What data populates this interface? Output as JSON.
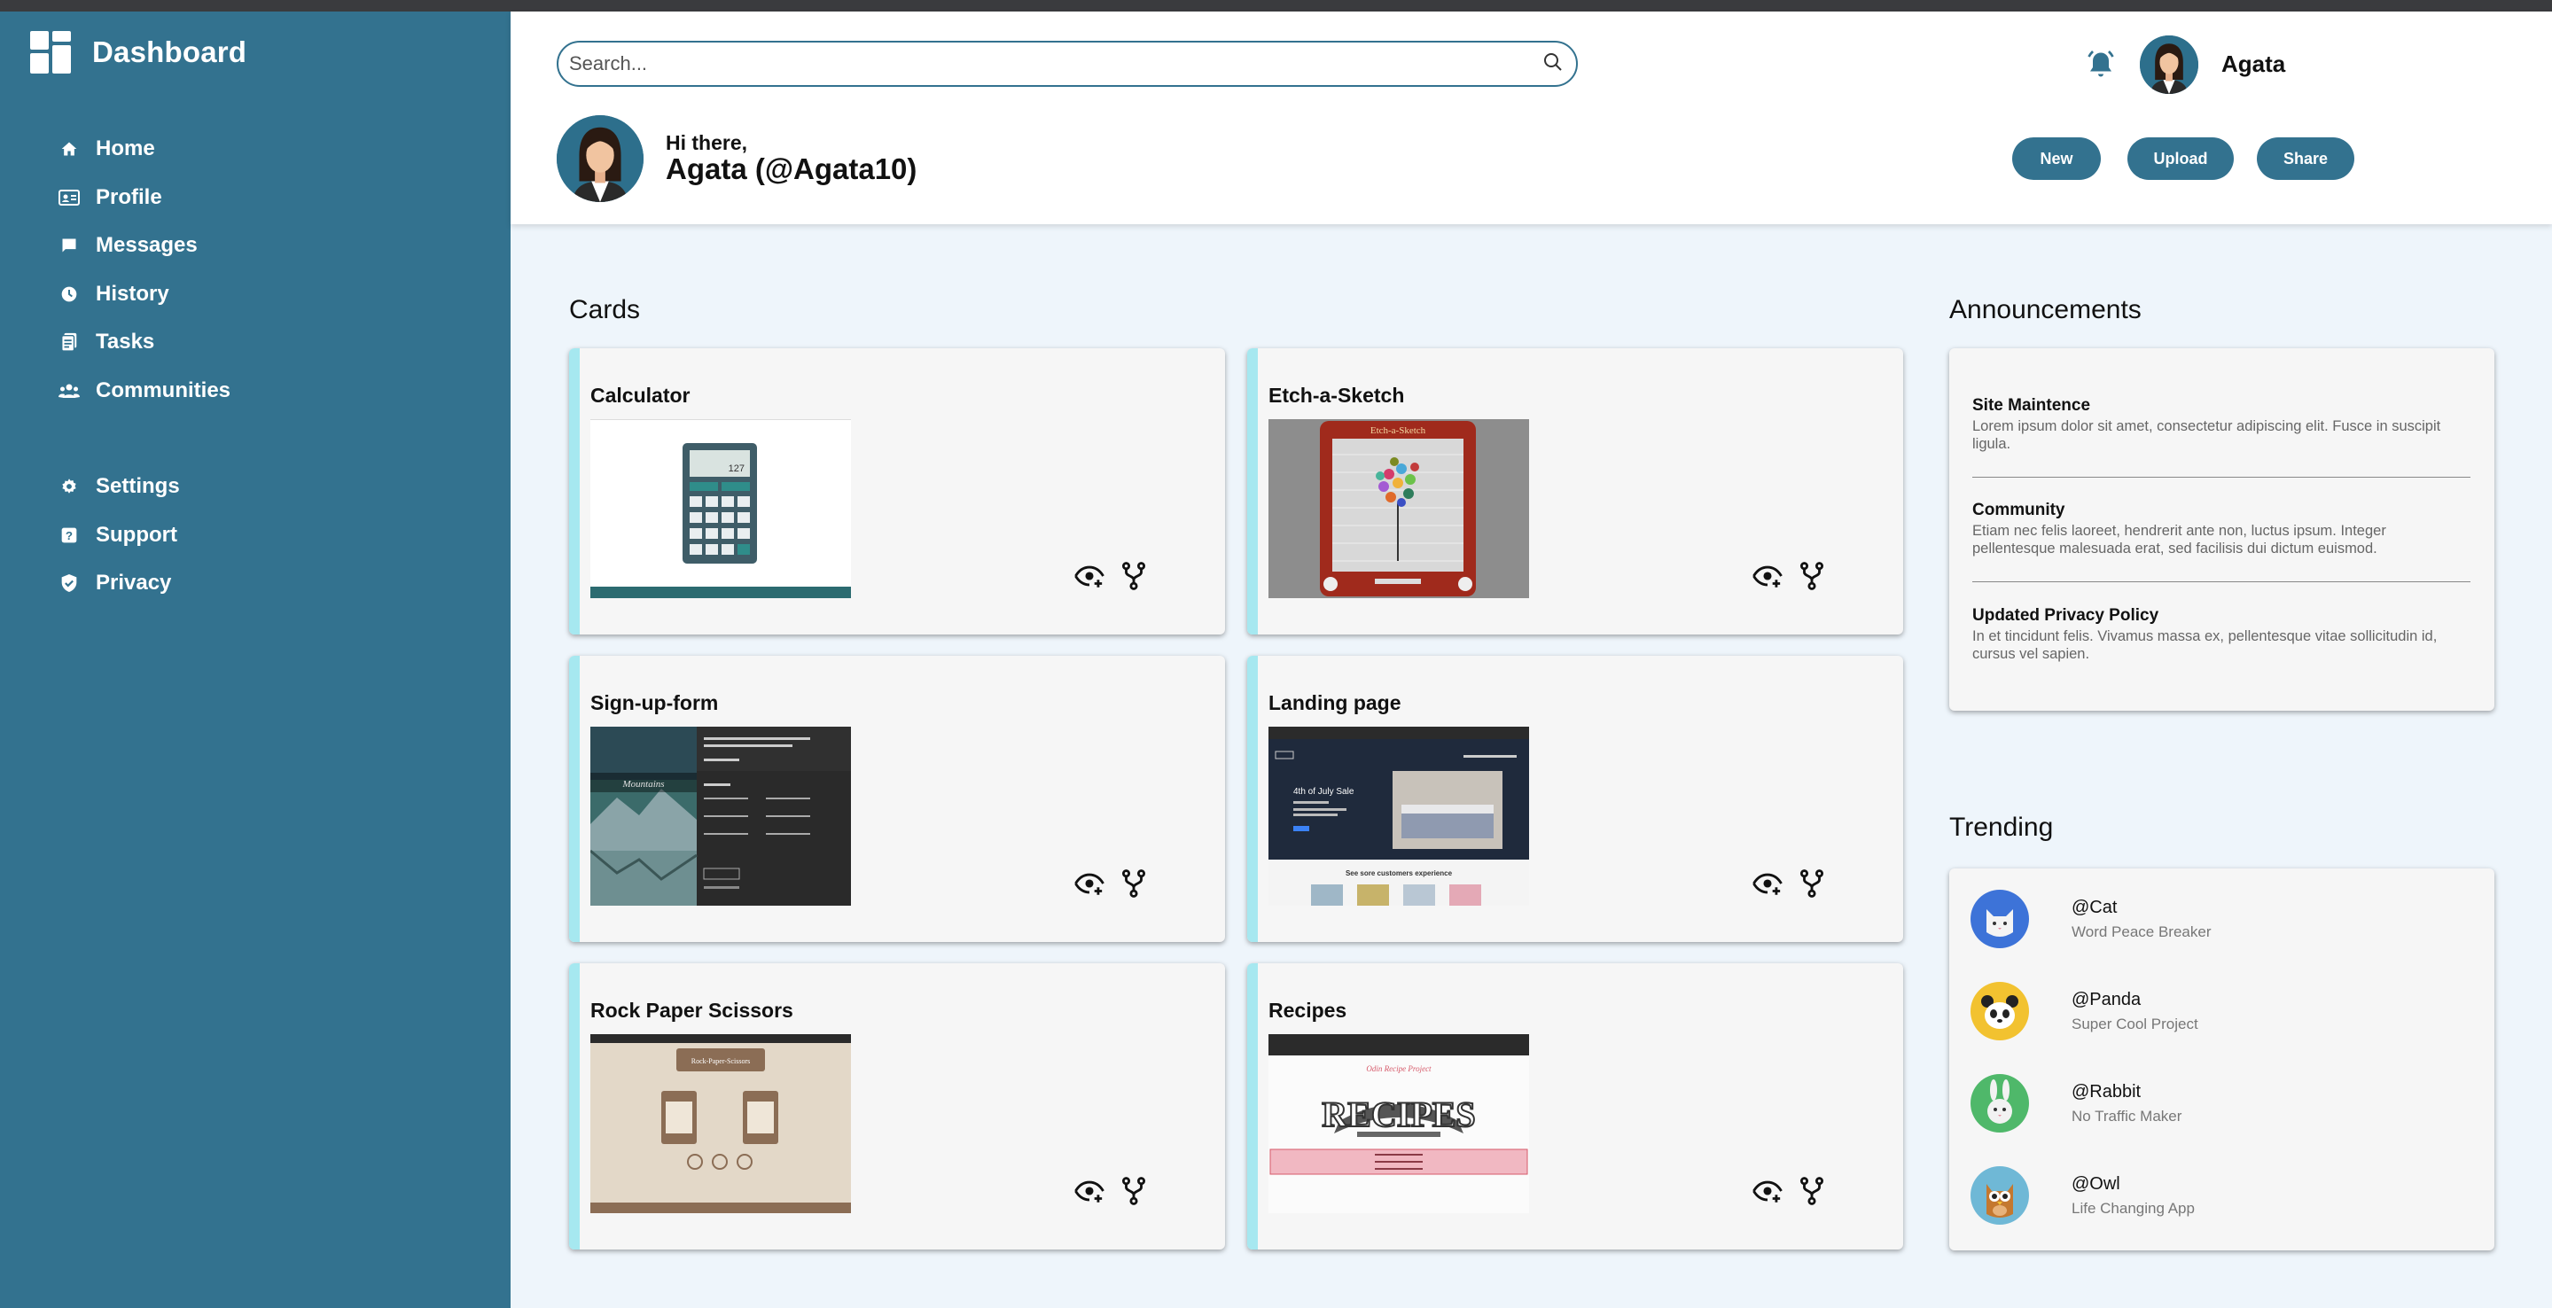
{
  "brand": {
    "title": "Dashboard"
  },
  "nav": {
    "items": [
      {
        "label": "Home",
        "icon": "home-icon"
      },
      {
        "label": "Profile",
        "icon": "profile-card-icon"
      },
      {
        "label": "Messages",
        "icon": "message-icon"
      },
      {
        "label": "History",
        "icon": "history-icon"
      },
      {
        "label": "Tasks",
        "icon": "tasks-icon"
      },
      {
        "label": "Communities",
        "icon": "communities-icon"
      }
    ],
    "secondary": [
      {
        "label": "Settings",
        "icon": "gear-icon"
      },
      {
        "label": "Support",
        "icon": "support-icon"
      },
      {
        "label": "Privacy",
        "icon": "shield-icon"
      }
    ]
  },
  "search": {
    "placeholder": "Search..."
  },
  "user": {
    "name": "Agata",
    "greeting": "Hi there,",
    "display": "Agata (@Agata10)"
  },
  "actions": {
    "new": "New",
    "upload": "Upload",
    "share": "Share"
  },
  "cards": {
    "title": "Cards",
    "items": [
      {
        "title": "Calculator"
      },
      {
        "title": "Etch-a-Sketch"
      },
      {
        "title": "Sign-up-form"
      },
      {
        "title": "Landing page"
      },
      {
        "title": "Rock Paper Scissors"
      },
      {
        "title": "Recipes"
      }
    ]
  },
  "announcements": {
    "title": "Announcements",
    "items": [
      {
        "title": "Site Maintence",
        "body": "Lorem ipsum dolor sit amet, consectetur adipiscing elit. Fusce in suscipit ligula."
      },
      {
        "title": "Community",
        "body": "Etiam nec felis laoreet, hendrerit ante non, luctus ipsum. Integer pellentesque malesuada erat, sed facilisis dui dictum euismod."
      },
      {
        "title": "Updated Privacy Policy",
        "body": "In et tincidunt felis. Vivamus massa ex, pellentesque vitae sollicitudin id, cursus vel sapien."
      }
    ]
  },
  "trending": {
    "title": "Trending",
    "items": [
      {
        "handle": "@Cat",
        "project": "Word Peace Breaker",
        "color": "#3d73d8"
      },
      {
        "handle": "@Panda",
        "project": "Super Cool Project",
        "color": "#f2c230"
      },
      {
        "handle": "@Rabbit",
        "project": "No Traffic Maker",
        "color": "#4fb86a"
      },
      {
        "handle": "@Owl",
        "project": "Life Changing App",
        "color": "#6fb8d6"
      }
    ]
  },
  "thumbs": {
    "calc_display": "127",
    "etch_title": "Etch-a-Sketch",
    "signup_brand": "Mountains",
    "landing_sale": "4th of July Sale",
    "landing_section": "See sore customers experience",
    "rps_title": "Rock-Paper-Scissors",
    "recipes_logo": "RECIPES",
    "recipes_sub": "Odin Recipe Project"
  },
  "colors": {
    "sidebar": "#33728f",
    "accent": "#a6e8f0",
    "background": "#eef5fb"
  }
}
